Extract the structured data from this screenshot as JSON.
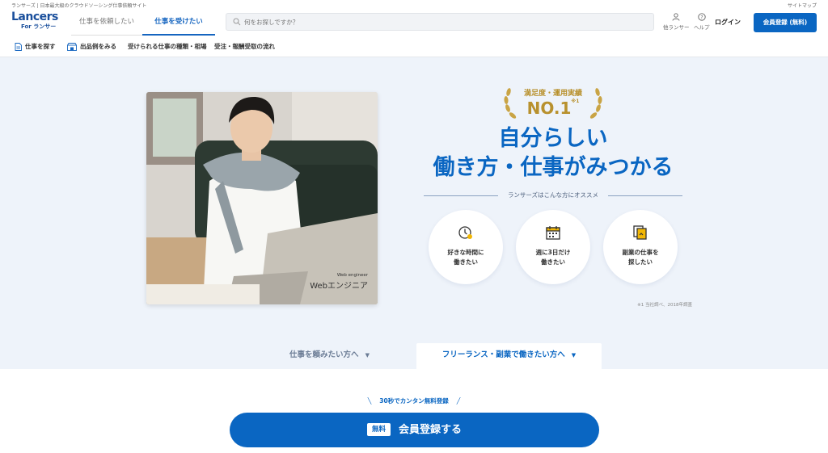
{
  "top_strip": {
    "tagline": "ランサーズ | 日本最大級のクラウドソーシング仕事依頼サイト",
    "sitemap": "サイトマップ"
  },
  "header": {
    "logo_main": "Lancers",
    "logo_sub": "For ランサー",
    "tab_client": "仕事を依頼したい",
    "tab_worker": "仕事を受けたい",
    "search_placeholder": "何をお探しですか？",
    "icon_other": "他ランサー",
    "icon_help": "ヘルプ",
    "login": "ログイン",
    "register": "会員登録 (無料)"
  },
  "subnav": {
    "items": [
      "仕事を探す",
      "出品例をみる",
      "受けられる仕事の種類・相場",
      "受注・報酬受取の流れ"
    ]
  },
  "hero": {
    "photo_caption_sub": "Web engineer",
    "photo_caption": "Webエンジニア",
    "award_title": "満足度・運用実績",
    "award_number": "NO.1",
    "award_mark": "※1",
    "headline_line1": "自分らしい",
    "headline_line2": "働き方・仕事がみつかる",
    "recommend_label": "ランサーズはこんな方にオススメ",
    "circles": [
      {
        "label": "好きな時間に\n働きたい",
        "icon": "clock-icon"
      },
      {
        "label": "週に3日だけ\n働きたい",
        "icon": "calendar-icon"
      },
      {
        "label": "副業の仕事を\n探したい",
        "icon": "documents-icon"
      }
    ],
    "footnote": "※1 当社調べ、2018年調査"
  },
  "segments": {
    "left": "仕事を頼みたい方へ",
    "right": "フリーランス・副業で働きたい方へ"
  },
  "cta": {
    "promo": "30秒でカンタン無料登録",
    "badge": "無料",
    "button": "会員登録する"
  },
  "colors": {
    "brand_blue": "#0a66c2",
    "gold": "#b8912e",
    "background": "#eef3fa"
  }
}
